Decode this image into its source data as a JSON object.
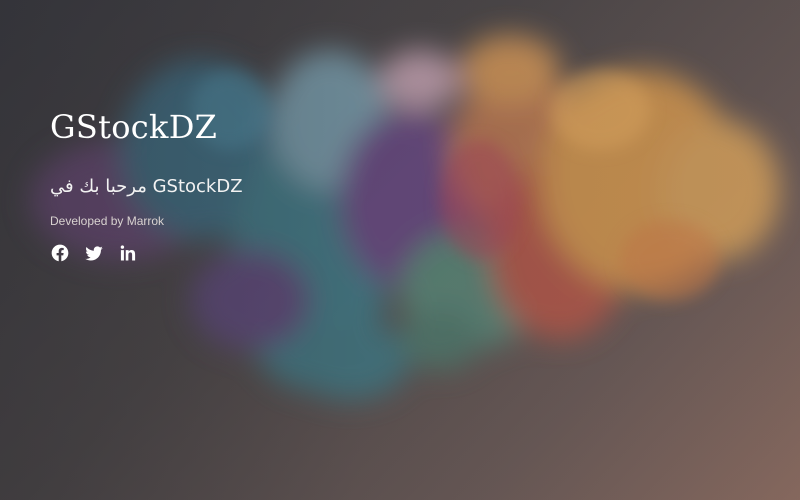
{
  "hero": {
    "title": "GStockDZ",
    "subtitle": "مرحبا بك في GStockDZ",
    "credit": "Developed by Marrok"
  },
  "socials": [
    {
      "icon": "facebook-icon"
    },
    {
      "icon": "twitter-icon"
    },
    {
      "icon": "linkedin-icon"
    }
  ],
  "colors": {
    "background": "#4a4648",
    "text": "#ffffff",
    "credit_text": "#d8d2d0"
  }
}
